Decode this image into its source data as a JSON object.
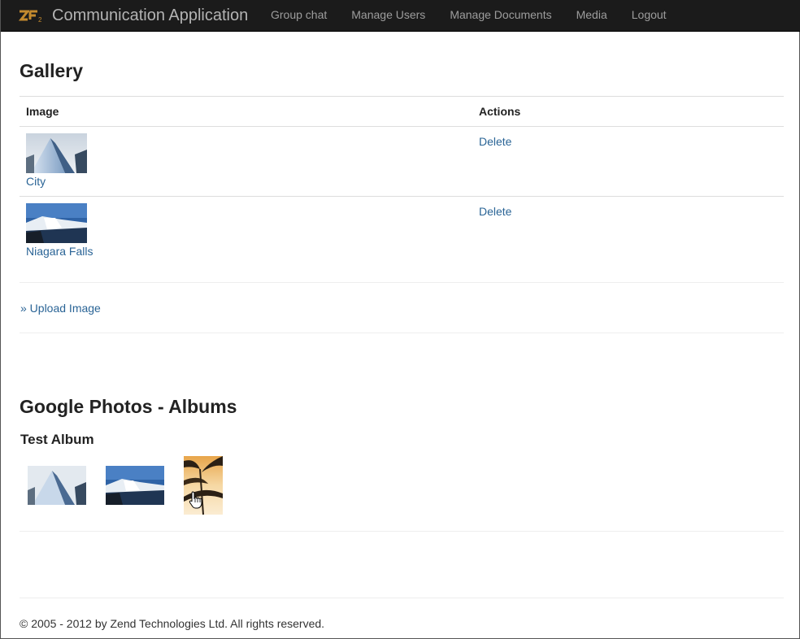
{
  "navbar": {
    "logo_icon": "zf2-logo-icon",
    "brand": "Communication Application",
    "items": [
      {
        "label": "Group chat"
      },
      {
        "label": "Manage Users"
      },
      {
        "label": "Manage Documents"
      },
      {
        "label": "Media"
      },
      {
        "label": "Logout"
      }
    ]
  },
  "gallery": {
    "title": "Gallery",
    "columns": [
      "Image",
      "Actions"
    ],
    "rows": [
      {
        "caption": "City",
        "action": "Delete",
        "thumbnail": "city-skyscraper-thumbnail"
      },
      {
        "caption": "Niagara Falls",
        "action": "Delete",
        "thumbnail": "niagara-falls-thumbnail"
      }
    ],
    "upload_link": "» Upload Image"
  },
  "albums": {
    "title": "Google Photos - Albums",
    "album_name": "Test Album",
    "photos": [
      "city-skyscraper-photo",
      "niagara-falls-photo",
      "palm-tree-sunset-photo"
    ]
  },
  "footer": {
    "copyright": "© 2005 - 2012 by Zend Technologies Ltd. All rights reserved."
  }
}
